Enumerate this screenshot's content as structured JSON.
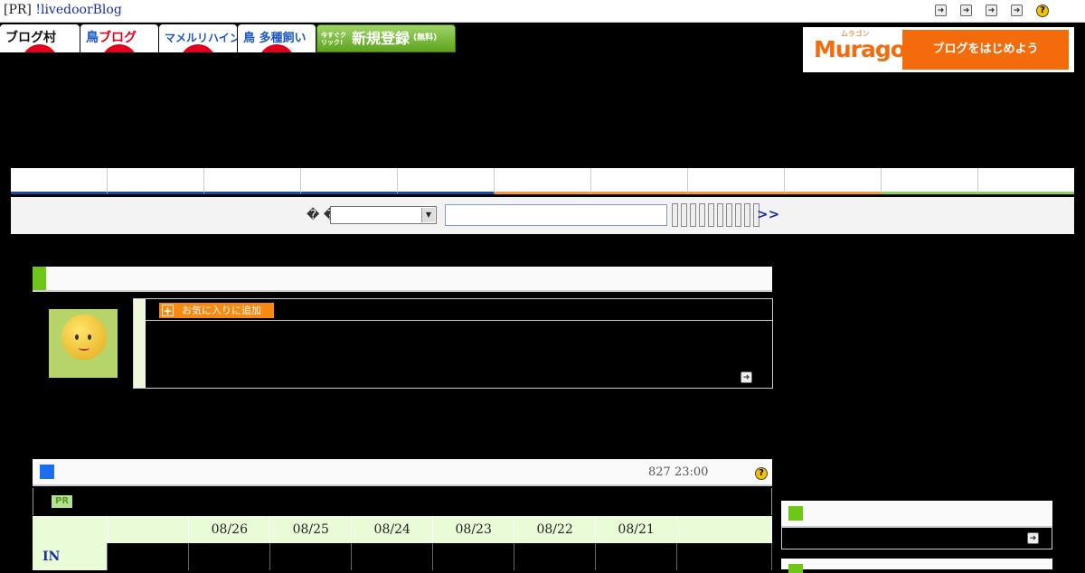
{
  "topbar": {
    "pr_prefix": "[PR] ",
    "pr_link": "!livedoorBlog",
    "icons": [
      "next-arrow-icon",
      "next-arrow-icon",
      "next-arrow-icon",
      "next-arrow-icon",
      "help-icon"
    ],
    "help_glyph": "?"
  },
  "banners": {
    "blogmura": "ブログ村",
    "bird_blog_a": "鳥",
    "bird_blog_b": "ブログ",
    "mameruri": "マメルリハインコ",
    "tashu": "鳥 多種飼い",
    "register_small": "今すぐクリック!",
    "register": "新規登録",
    "register_free": "(無料)"
  },
  "muragon": {
    "logo": "Muragon",
    "ruby": "ムラゴン",
    "cta": "ブログをはじめよう"
  },
  "search": {
    "label": "� �",
    "go": ">>",
    "input_value": "",
    "select_value": ""
  },
  "profile": {
    "favorite_label": "お気に入りに追加",
    "favorite_plus": "+"
  },
  "access": {
    "date_label": "827 23:00",
    "help_glyph": "?",
    "pr_badge": "PR",
    "columns": [
      "",
      "",
      "08/26",
      "08/25",
      "08/24",
      "08/23",
      "08/22",
      "08/21",
      ""
    ],
    "rows": [
      {
        "label": "IN"
      }
    ]
  },
  "colors": {
    "accent_green": "#6fc51a",
    "accent_blue": "#1b6ef0",
    "muragon_orange": "#f36b0b",
    "favorite_orange": "#f68a12"
  }
}
